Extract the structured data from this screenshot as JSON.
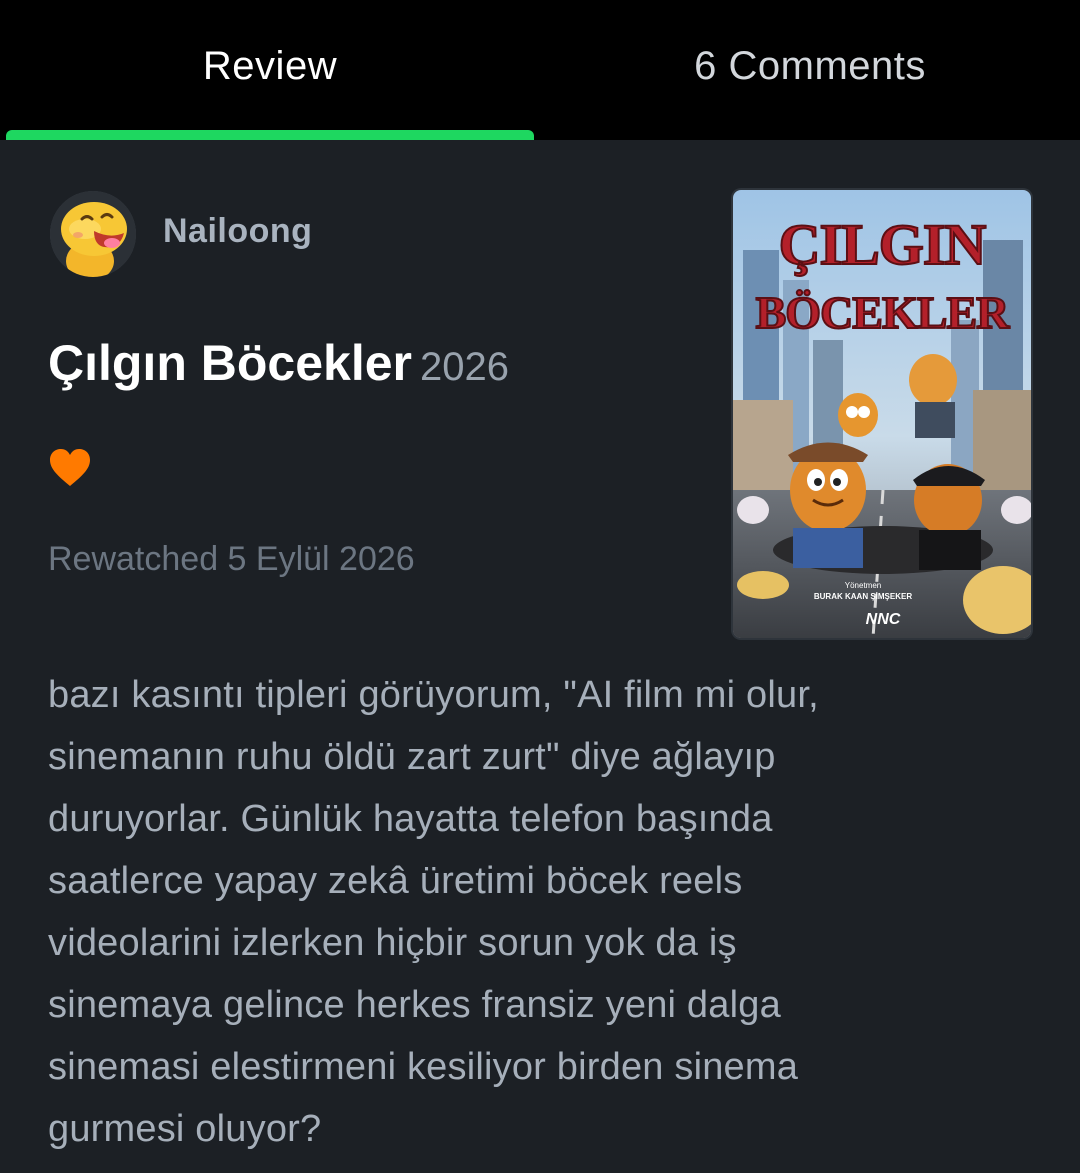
{
  "tabs": {
    "review_label": "Review",
    "comments_label": "6 Comments",
    "active": "review",
    "accent_color": "#1ed760"
  },
  "review": {
    "username": "Nailoong",
    "avatar_icon": "yellow-dinosaur-avatar",
    "film_title": "Çılgın Böcekler",
    "film_year": "2026",
    "liked": true,
    "like_icon": "heart-icon",
    "like_color": "#ff7a00",
    "watch_status": "Rewatched 5 Eylül 2026",
    "body_lines": [
      "bazı kasıntı tipleri görüyorum, \"AI film mi olur,",
      "sinemanın ruhu öldü zart zurt\" diye ağlayıp",
      "duruyorlar. Günlük hayatta telefon başında",
      "saatlerce yapay zekâ üretimi böcek reels",
      "videolarini izlerken hiçbir sorun yok da iş",
      "sinemaya gelince herkes fransiz yeni dalga",
      "sinemasi elestirmeni kesiliyor birden sinema",
      "gurmesi oluyor?"
    ]
  },
  "poster": {
    "title_line1": "ÇILGIN",
    "title_line2": "BÖCEKLER",
    "director_label": "Yönetmen",
    "director_name": "BURAK KAAN ŞİMŞEKER",
    "studio_logo": "NNC"
  }
}
